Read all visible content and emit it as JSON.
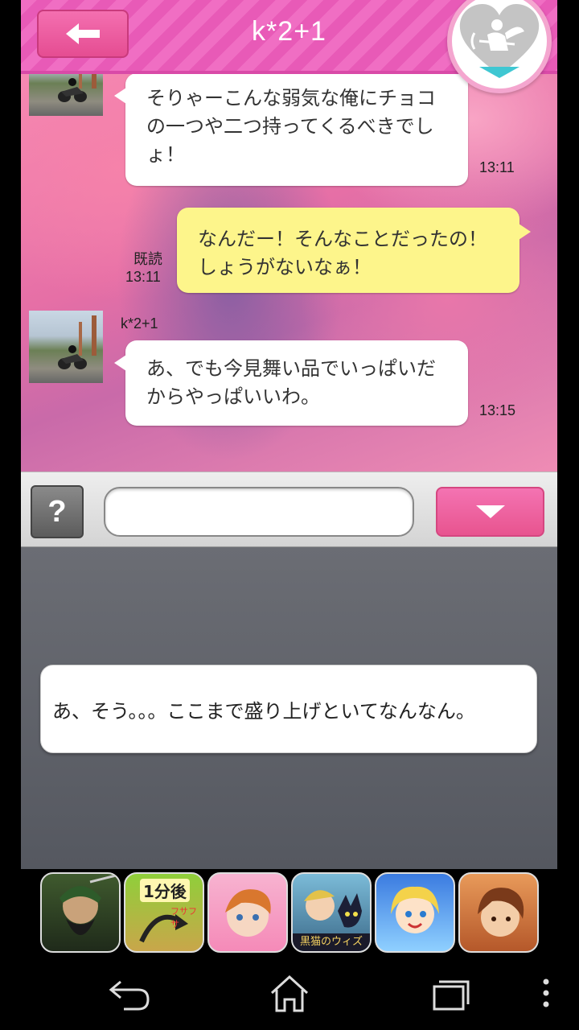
{
  "header": {
    "title": "k*2+1",
    "back_icon": "back-arrow-icon",
    "badge_icon": "cupid-heart-icon"
  },
  "messages": [
    {
      "from": "other",
      "text_lines": [
        "そりゃーこんな弱気な俺にチョコ",
        "の一つや二つ持ってくるべきでし",
        "ょ！"
      ],
      "time": "13:11"
    },
    {
      "from": "me",
      "text_lines": [
        "なんだー！そんなことだったの！",
        "しょうがないなぁ！"
      ],
      "read_label": "既読",
      "time": "13:11"
    },
    {
      "from": "other",
      "sender": "k*2+1",
      "text_lines": [
        "あ、でも今見舞い品でいっぱいだ",
        "からやっぱいいわ。"
      ],
      "time": "13:15"
    }
  ],
  "input": {
    "help_label": "?",
    "value": "",
    "placeholder": ""
  },
  "reply_options": [
    "あ、そう。。。ここまで盛り上げといてなんなん。"
  ],
  "ads": {
    "ad2_caption": "1分後",
    "ad2_sub": "フサフサ",
    "ad5_caption": "黒猫のウィズ"
  },
  "colors": {
    "header_pink": "#f06ec3",
    "button_pink": "#e8548f",
    "my_bubble": "#fdf58b",
    "their_bubble": "#ffffff",
    "panel_gray": "#5b5e66"
  }
}
